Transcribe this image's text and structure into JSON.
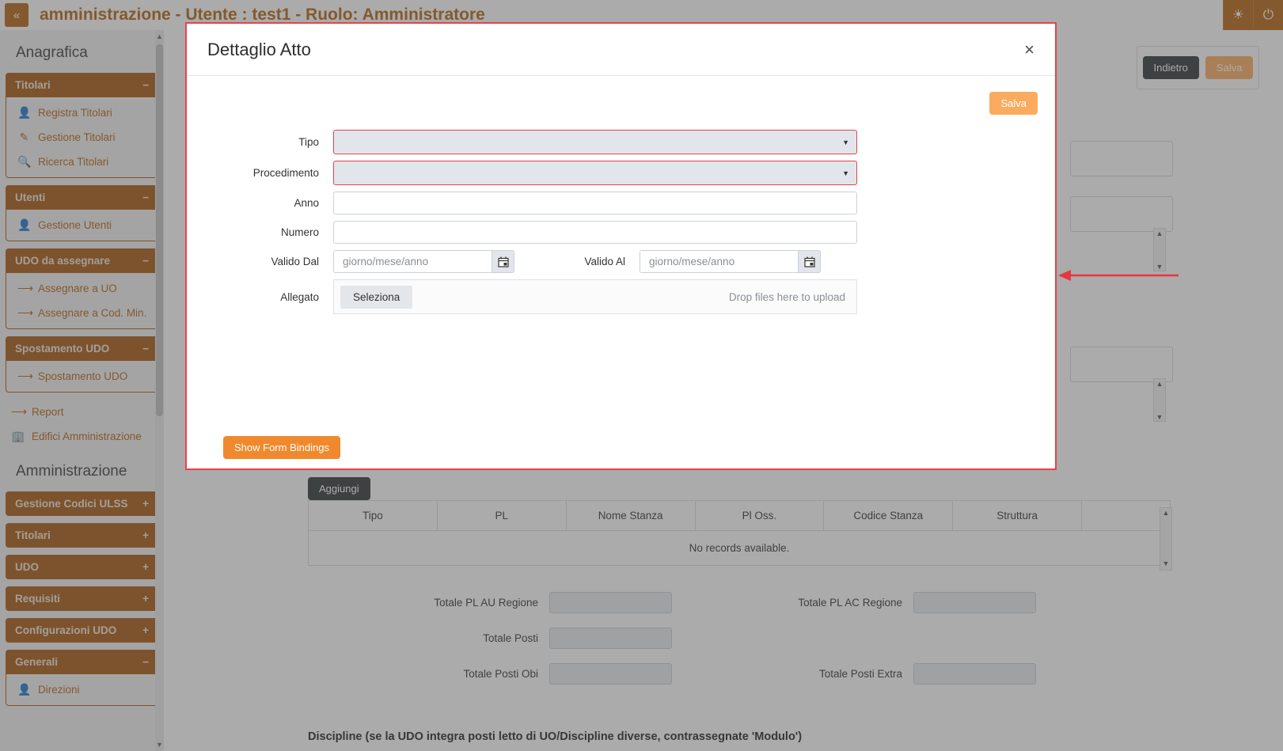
{
  "topbar": {
    "collapse_icon": "double-chevron-left",
    "title": "amministrazione - Utente : test1 - Ruolo: Amministratore",
    "icons": [
      {
        "name": "globe-icon",
        "glyph": "⊕"
      },
      {
        "name": "power-icon",
        "glyph": "⏻"
      }
    ],
    "accent_color": "#b5620f"
  },
  "sidebar": {
    "sections": [
      {
        "title": "Anagrafica",
        "panels": [
          {
            "label": "Titolari",
            "toggle": "−",
            "expanded": true,
            "items": [
              {
                "label": "Registra Titolari",
                "icon": "user-add-icon",
                "glyph": "὆4"
              },
              {
                "label": "Gestione Titolari",
                "icon": "edit-icon",
                "glyph": "✎"
              },
              {
                "label": "Ricerca Titolari",
                "icon": "search-icon",
                "glyph": "ὐD"
              }
            ]
          },
          {
            "label": "Utenti",
            "toggle": "−",
            "expanded": true,
            "items": [
              {
                "label": "Gestione Utenti",
                "icon": "user-edit-icon",
                "glyph": "὆4"
              }
            ]
          },
          {
            "label": "UDO da assegnare",
            "toggle": "−",
            "expanded": true,
            "items": [
              {
                "label": "Assegnare a UO",
                "icon": "arrow-right-icon",
                "glyph": "→"
              },
              {
                "label": "Assegnare a Cod. Min.",
                "icon": "arrow-right-icon",
                "glyph": "→"
              }
            ]
          },
          {
            "label": "Spostamento UDO",
            "toggle": "−",
            "expanded": true,
            "items": [
              {
                "label": "Spostamento UDO",
                "icon": "arrow-right-icon",
                "glyph": "→"
              }
            ]
          }
        ],
        "loose_items": [
          {
            "label": "Report",
            "icon": "arrow-right-icon",
            "glyph": "→"
          },
          {
            "label": "Edifici Amministrazione",
            "icon": "building-icon",
            "glyph": "Ἶ2"
          }
        ]
      },
      {
        "title": "Amministrazione",
        "panels": [
          {
            "label": "Gestione Codici ULSS",
            "toggle": "+",
            "expanded": false,
            "items": []
          },
          {
            "label": "Titolari",
            "toggle": "+",
            "expanded": false,
            "items": []
          },
          {
            "label": "UDO",
            "toggle": "+",
            "expanded": false,
            "items": []
          },
          {
            "label": "Requisiti",
            "toggle": "+",
            "expanded": false,
            "items": []
          },
          {
            "label": "Configurazioni UDO",
            "toggle": "+",
            "expanded": false,
            "items": []
          },
          {
            "label": "Generali",
            "toggle": "−",
            "expanded": true,
            "items": [
              {
                "label": "Direzioni",
                "icon": "user-icon",
                "glyph": "὆4"
              }
            ]
          }
        ],
        "loose_items": []
      }
    ]
  },
  "page_actions": {
    "indietro_label": "Indietro",
    "salva_label": "Salva"
  },
  "modal": {
    "title": "Dettaglio Atto",
    "close_label": "×",
    "save_label": "Salva",
    "bindings_label": "Show Form Bindings",
    "border_color": "#e8424a",
    "fields": [
      {
        "label": "Tipo",
        "type": "select",
        "value": "",
        "required": true
      },
      {
        "label": "Procedimento",
        "type": "select",
        "value": "",
        "required": true
      },
      {
        "label": "Anno",
        "type": "text",
        "value": "",
        "required": false
      },
      {
        "label": "Numero",
        "type": "text",
        "value": "",
        "required": false
      }
    ],
    "date_from": {
      "label": "Valido Dal",
      "placeholder": "giorno/mese/anno",
      "value": ""
    },
    "date_to": {
      "label": "Valido Al",
      "placeholder": "giorno/mese/anno",
      "value": ""
    },
    "attachment": {
      "label": "Allegato",
      "button_label": "Seleziona",
      "hint": "Drop files here to upload"
    },
    "caret_glyph": "▼",
    "calendar_glyph": "📅"
  },
  "background_table": {
    "add_label": "Aggiungi",
    "columns": [
      "Tipo",
      "PL",
      "Nome Stanza",
      "Pl Oss.",
      "Codice Stanza",
      "Struttura",
      ""
    ],
    "empty_message": "No records available."
  },
  "totals": [
    {
      "label": "Totale PL AU Regione",
      "value": ""
    },
    {
      "label": "Totale PL AC Regione",
      "value": ""
    },
    {
      "label": "Totale Posti",
      "value": ""
    },
    {
      "label": "Totale Posti Obi",
      "value": ""
    },
    {
      "label": "Totale Posti Extra",
      "value": ""
    }
  ],
  "discipline_title": "Discipline (se la UDO integra posti letto di UO/Discipline diverse, contrassegnate 'Modulo')",
  "annotation": {
    "name": "red-arrow-pointer",
    "color": "#e8353f"
  }
}
